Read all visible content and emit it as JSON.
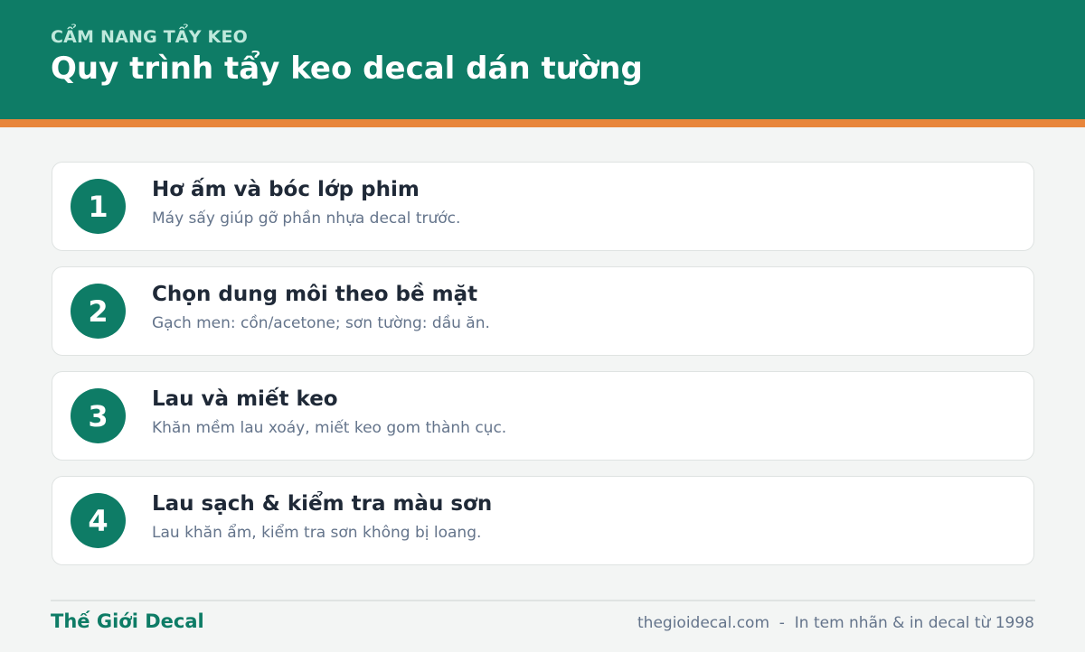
{
  "colors": {
    "brand": "#0e7c66",
    "accent": "#e8863b",
    "background": "#f3f5f4",
    "card": "#ffffff",
    "text_dark": "#1f2937",
    "text_muted": "#64748b"
  },
  "header": {
    "eyebrow": "CẨM NANG TẨY KEO",
    "title": "Quy trình tẩy keo decal dán tường"
  },
  "steps": [
    {
      "number": "1",
      "title": "Hơ ấm và bóc lớp phim",
      "description": "Máy sấy giúp gỡ phần nhựa decal trước."
    },
    {
      "number": "2",
      "title": "Chọn dung môi theo bề mặt",
      "description": "Gạch men: cồn/acetone; sơn tường: dầu ăn."
    },
    {
      "number": "3",
      "title": "Lau và miết keo",
      "description": "Khăn mềm lau xoáy, miết keo gom thành cục."
    },
    {
      "number": "4",
      "title": "Lau sạch & kiểm tra màu sơn",
      "description": "Lau khăn ẩm, kiểm tra sơn không bị loang."
    }
  ],
  "footer": {
    "brand": "Thế Giới Decal",
    "info": "thegioidecal.com  -  In tem nhãn & in decal từ 1998"
  }
}
